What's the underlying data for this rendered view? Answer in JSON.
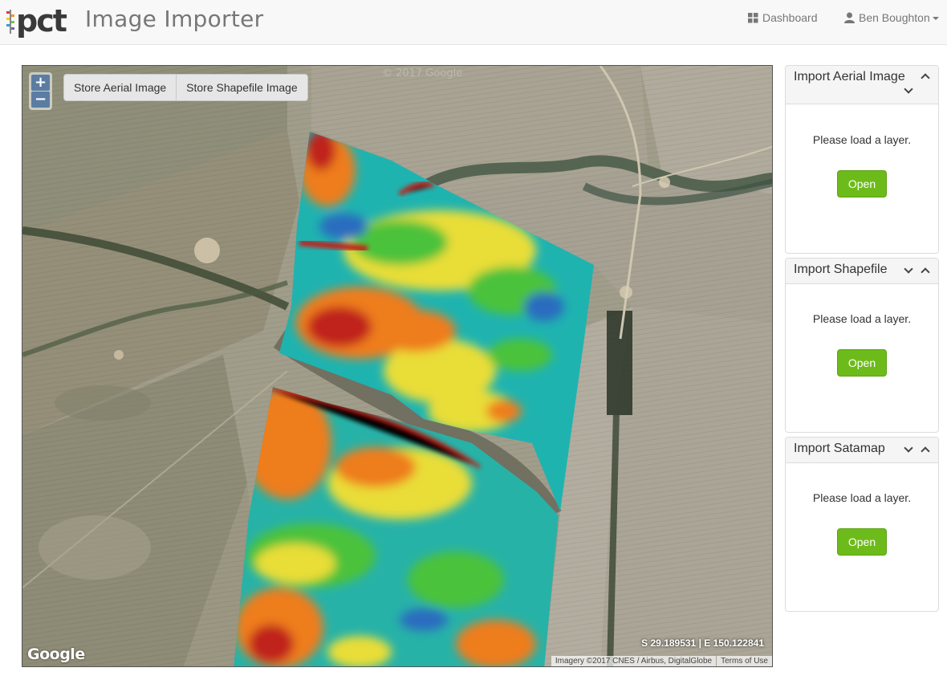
{
  "header": {
    "logo_text": "pct",
    "app_title": "Image Importer",
    "dashboard_label": "Dashboard",
    "user_name": "Ben Boughton"
  },
  "map": {
    "zoom_in_label": "+",
    "zoom_out_label": "−",
    "store_aerial_label": "Store Aerial Image",
    "store_shapefile_label": "Store Shapefile Image",
    "coordinates": "S 29.189531 | E 150.122841",
    "google_logo": "Google",
    "attribution": "Imagery ©2017 CNES / Airbus, DigitalGlobe",
    "terms_label": "Terms of Use",
    "watermark": "© 2017 Google"
  },
  "panels": [
    {
      "title": "Import Aerial Image",
      "message": "Please load a layer.",
      "button_label": "Open"
    },
    {
      "title": "Import Shapefile",
      "message": "Please load a layer.",
      "button_label": "Open"
    },
    {
      "title": "Import Satamap",
      "message": "Please load a layer.",
      "button_label": "Open"
    }
  ],
  "colors": {
    "button_green": "#6dbb1a",
    "ndvi_red": "#c0221a",
    "ndvi_orange": "#ee7d1f",
    "ndvi_yellow": "#e8e03a",
    "ndvi_green": "#4cc23a",
    "ndvi_cyan": "#1db5b0",
    "ndvi_blue": "#2a6cc0"
  },
  "icons": {
    "dashboard": "grid-icon",
    "user": "user-icon",
    "collapse": "chevron-up-icon",
    "expand": "chevron-down-icon"
  }
}
